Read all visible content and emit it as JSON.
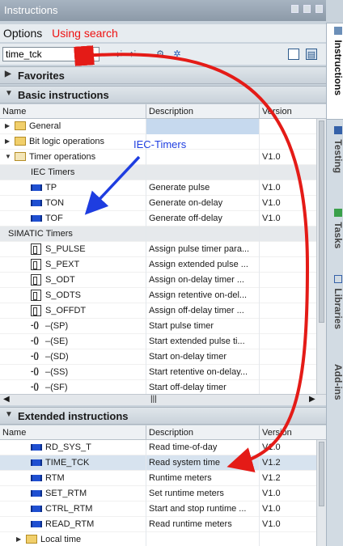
{
  "window": {
    "title": "Instructions"
  },
  "options": {
    "label": "Options",
    "annotation": "Using search"
  },
  "search": {
    "value": "time_tck"
  },
  "sections": {
    "favorites": "Favorites",
    "basic": "Basic instructions",
    "extended": "Extended instructions"
  },
  "columns": {
    "name": "Name",
    "description": "Description",
    "version": "Version"
  },
  "basic_rows": [
    {
      "name": "General",
      "desc": "",
      "ver": ""
    },
    {
      "name": "Bit logic operations",
      "desc": "",
      "ver": ""
    },
    {
      "name": "Timer operations",
      "desc": "",
      "ver": "V1.0"
    },
    {
      "name": "IEC Timers",
      "desc": "",
      "ver": ""
    },
    {
      "name": "TP",
      "desc": "Generate pulse",
      "ver": "V1.0"
    },
    {
      "name": "TON",
      "desc": "Generate on-delay",
      "ver": "V1.0"
    },
    {
      "name": "TOF",
      "desc": "Generate off-delay",
      "ver": "V1.0"
    },
    {
      "name": "SIMATIC Timers",
      "desc": "",
      "ver": ""
    },
    {
      "name": "S_PULSE",
      "desc": "Assign pulse timer para...",
      "ver": ""
    },
    {
      "name": "S_PEXT",
      "desc": "Assign extended pulse ...",
      "ver": ""
    },
    {
      "name": "S_ODT",
      "desc": "Assign on-delay timer ...",
      "ver": ""
    },
    {
      "name": "S_ODTS",
      "desc": "Assign retentive on-del...",
      "ver": ""
    },
    {
      "name": "S_OFFDT",
      "desc": "Assign off-delay timer ...",
      "ver": ""
    },
    {
      "name": "–(SP)",
      "desc": "Start pulse timer",
      "ver": ""
    },
    {
      "name": "–(SE)",
      "desc": "Start extended pulse ti...",
      "ver": ""
    },
    {
      "name": "–(SD)",
      "desc": "Start on-delay timer",
      "ver": ""
    },
    {
      "name": "–(SS)",
      "desc": "Start retentive on-delay...",
      "ver": ""
    },
    {
      "name": "–(SF)",
      "desc": "Start off-delay timer",
      "ver": ""
    }
  ],
  "extended_rows": [
    {
      "name": "RD_SYS_T",
      "desc": "Read time-of-day",
      "ver": "V1.0"
    },
    {
      "name": "TIME_TCK",
      "desc": "Read system time",
      "ver": "V1.2"
    },
    {
      "name": "RTM",
      "desc": "Runtime meters",
      "ver": "V1.2"
    },
    {
      "name": "SET_RTM",
      "desc": "Set runtime meters",
      "ver": "V1.0"
    },
    {
      "name": "CTRL_RTM",
      "desc": "Start and stop runtime ...",
      "ver": "V1.0"
    },
    {
      "name": "READ_RTM",
      "desc": "Read runtime meters",
      "ver": "V1.0"
    },
    {
      "name": "Local time",
      "desc": "",
      "ver": ""
    }
  ],
  "annotations": {
    "iec": "IEC-Timers",
    "arrow_color": "#e41b17",
    "iec_color": "#1e3de0"
  },
  "side_tabs": [
    "Instructions",
    "Testing",
    "Tasks",
    "Libraries",
    "Add-ins"
  ],
  "colors": {
    "title_bar": "#95a3b1",
    "selected_row": "#d7e3ef",
    "annotation_red": "#e41b17"
  }
}
